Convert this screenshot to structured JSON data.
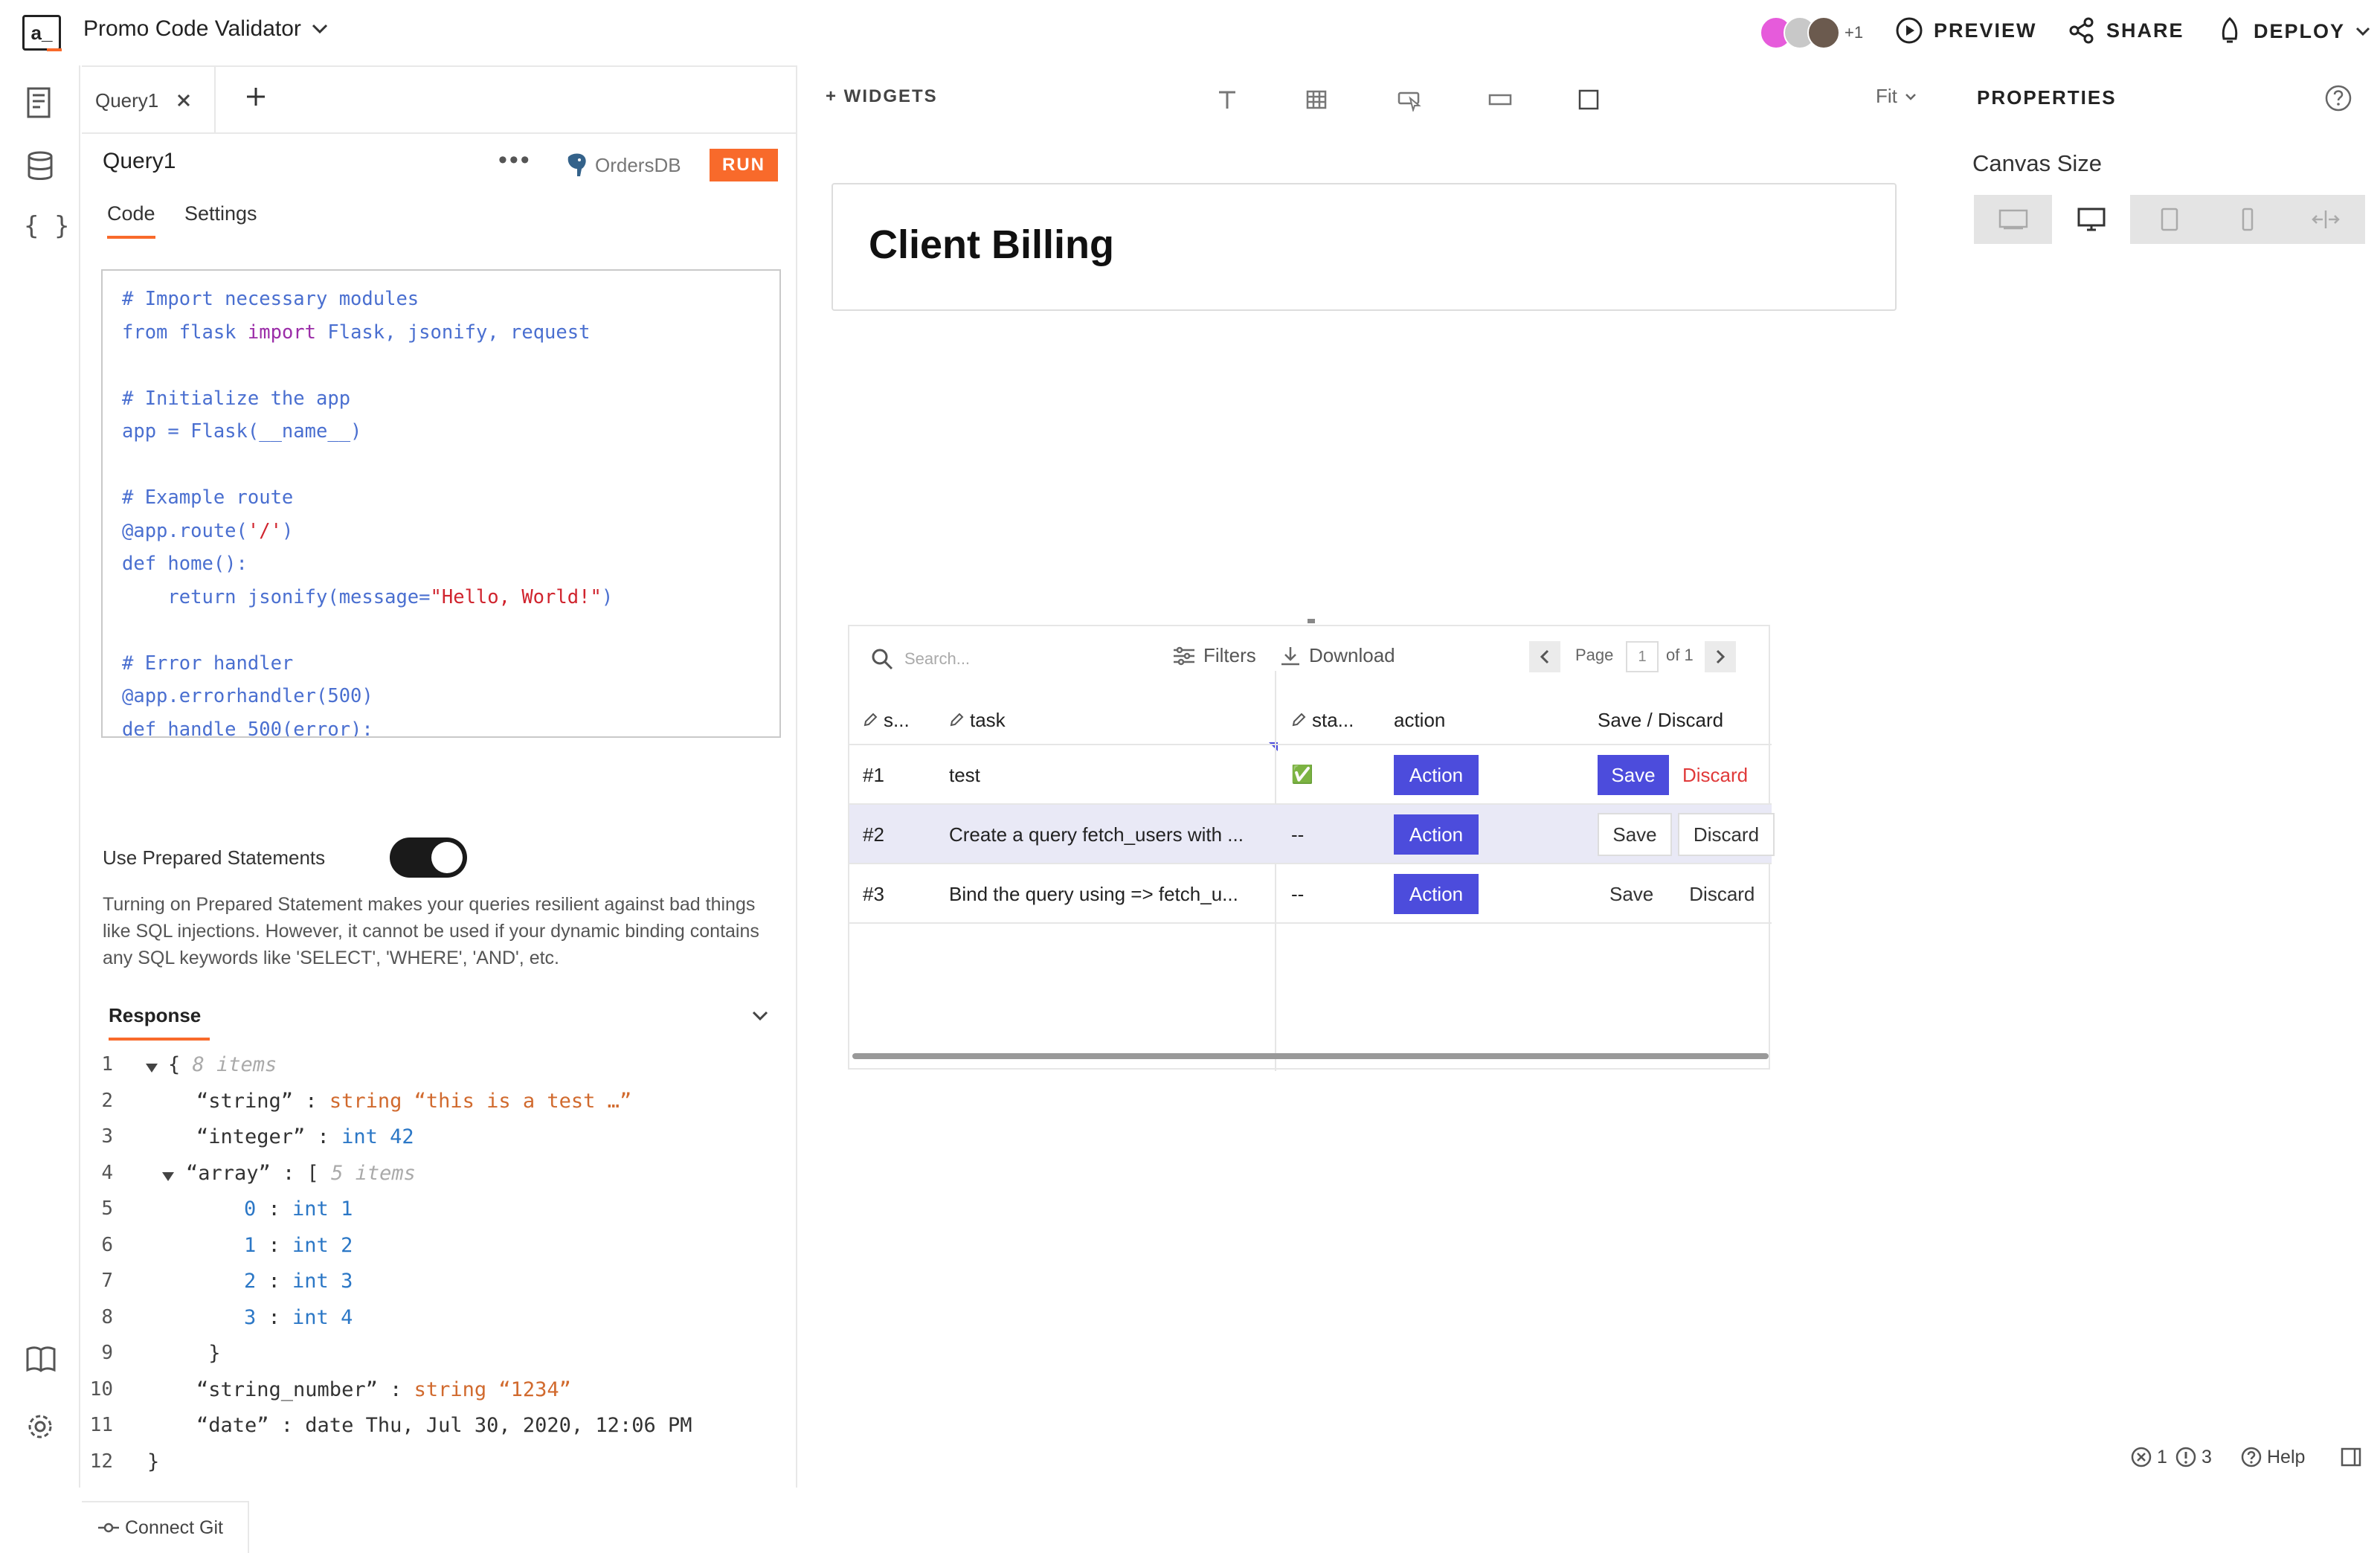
{
  "app": {
    "logo": "a_",
    "title": "Promo Code Validator",
    "extra_users": "+1"
  },
  "top_actions": {
    "preview": "PREVIEW",
    "share": "SHARE",
    "deploy": "DEPLOY"
  },
  "query_panel": {
    "tab": "Query1",
    "name": "Query1",
    "datasource": "OrdersDB",
    "run": "RUN",
    "subtabs": [
      "Code",
      "Settings"
    ],
    "code": [
      [
        {
          "c": "cm",
          "t": "# Import necessary modules"
        }
      ],
      [
        {
          "c": "id",
          "t": "from flask "
        },
        {
          "c": "kw",
          "t": "import"
        },
        {
          "c": "id",
          "t": " Flask, jsonify, request"
        }
      ],
      [],
      [
        {
          "c": "cm",
          "t": "# Initialize the app"
        }
      ],
      [
        {
          "c": "id",
          "t": "app = Flask(__name__)"
        }
      ],
      [],
      [
        {
          "c": "cm",
          "t": "# Example route"
        }
      ],
      [
        {
          "c": "id",
          "t": "@app.route("
        },
        {
          "c": "st",
          "t": "'/'"
        },
        {
          "c": "id",
          "t": ")"
        }
      ],
      [
        {
          "c": "id",
          "t": "def home():"
        }
      ],
      [
        {
          "c": "id",
          "t": "    return jsonify(message="
        },
        {
          "c": "st",
          "t": "\"Hello, World!\""
        },
        {
          "c": "id",
          "t": ")"
        }
      ],
      [],
      [
        {
          "c": "cm",
          "t": "# Error handler"
        }
      ],
      [
        {
          "c": "id",
          "t": "@app.errorhandler(500)"
        }
      ],
      [
        {
          "c": "id",
          "t": "def handle_500(error):"
        }
      ]
    ],
    "prepared_label": "Use Prepared Statements",
    "prepared_note": "Turning on Prepared Statement makes your queries resilient against bad things like SQL injections. However, it cannot be used if your dynamic binding contains any SQL keywords like 'SELECT', 'WHERE', 'AND', etc.",
    "response_tab": "Response",
    "response_lines": [
      {
        "n": "1",
        "indent": 0,
        "arrow": true,
        "parts": [
          {
            "c": "k",
            "t": "{ "
          },
          {
            "c": "hint",
            "t": "8 items"
          }
        ]
      },
      {
        "n": "2",
        "indent": 1,
        "parts": [
          {
            "c": "k",
            "t": "“string” : "
          },
          {
            "c": "str",
            "t": "string “this is a test …”"
          }
        ]
      },
      {
        "n": "3",
        "indent": 1,
        "parts": [
          {
            "c": "k",
            "t": "“integer” : "
          },
          {
            "c": "int",
            "t": "int 42"
          }
        ]
      },
      {
        "n": "4",
        "indent": 1,
        "arrow": true,
        "parts": [
          {
            "c": "k",
            "t": "“array” : [ "
          },
          {
            "c": "hint",
            "t": "5 items"
          }
        ]
      },
      {
        "n": "5",
        "indent": 2,
        "parts": [
          {
            "c": "int",
            "t": "0"
          },
          {
            "c": "k",
            "t": " : "
          },
          {
            "c": "int",
            "t": "int 1"
          }
        ]
      },
      {
        "n": "6",
        "indent": 2,
        "parts": [
          {
            "c": "int",
            "t": "1"
          },
          {
            "c": "k",
            "t": " : "
          },
          {
            "c": "int",
            "t": "int 2"
          }
        ]
      },
      {
        "n": "7",
        "indent": 2,
        "parts": [
          {
            "c": "int",
            "t": "2"
          },
          {
            "c": "k",
            "t": " : "
          },
          {
            "c": "int",
            "t": "int 3"
          }
        ]
      },
      {
        "n": "8",
        "indent": 2,
        "parts": [
          {
            "c": "int",
            "t": "3"
          },
          {
            "c": "k",
            "t": " : "
          },
          {
            "c": "int",
            "t": "int 4"
          }
        ]
      },
      {
        "n": "9",
        "indent": 1,
        "parts": [
          {
            "c": "k",
            "t": " }"
          }
        ]
      },
      {
        "n": "10",
        "indent": 1,
        "parts": [
          {
            "c": "k",
            "t": "“string_number” : "
          },
          {
            "c": "str",
            "t": "string “1234”"
          }
        ]
      },
      {
        "n": "11",
        "indent": 1,
        "parts": [
          {
            "c": "k",
            "t": "“date” : date Thu, Jul 30, 2020, 12:06 PM"
          }
        ]
      },
      {
        "n": "12",
        "indent": 0,
        "parts": [
          {
            "c": "k",
            "t": "}"
          }
        ]
      }
    ],
    "connect_git": "Connect Git"
  },
  "canvas": {
    "widgets_label": "+ WIDGETS",
    "fit": "Fit",
    "card_title": "Client Billing",
    "table": {
      "search_placeholder": "Search...",
      "filters": "Filters",
      "download": "Download",
      "page_label": "Page",
      "page_value": "1",
      "page_of": "of 1",
      "columns": [
        "s...",
        "task",
        "sta...",
        "action",
        "Save / Discard"
      ],
      "rows": [
        {
          "id": "#1",
          "task": "test",
          "status": "✅",
          "action": "Action",
          "save": "Save",
          "discard": "Discard"
        },
        {
          "id": "#2",
          "task": "Create a query fetch_users with ...",
          "status": "--",
          "action": "Action",
          "save": "Save",
          "discard": "Discard"
        },
        {
          "id": "#3",
          "task": "Bind the query using => fetch_u...",
          "status": "--",
          "action": "Action",
          "save": "Save",
          "discard": "Discard"
        }
      ]
    }
  },
  "properties": {
    "title": "PROPERTIES",
    "canvas_size": "Canvas Size"
  },
  "status_bar": {
    "errors": "1",
    "warnings": "3",
    "help": "Help"
  }
}
